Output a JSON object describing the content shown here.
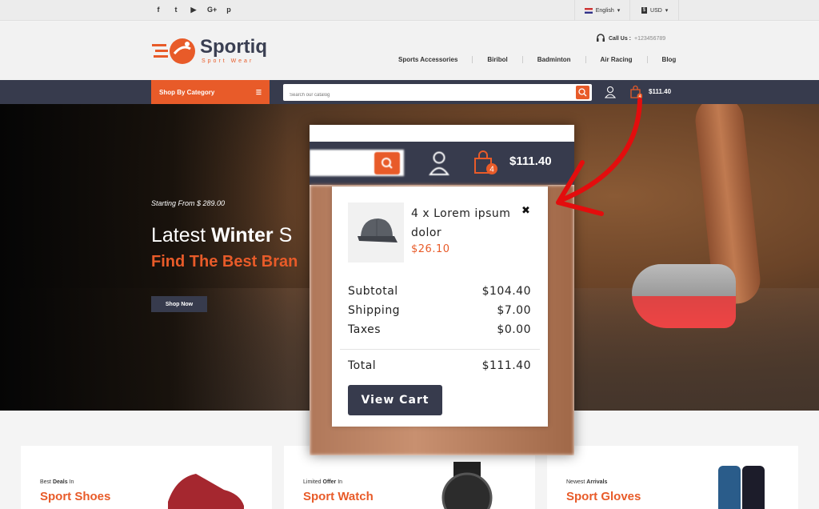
{
  "topbar": {
    "social": [
      "f",
      "t",
      "▶",
      "G+",
      "p"
    ],
    "language": "English",
    "currency": "USD",
    "currency_symbol": "$"
  },
  "header": {
    "logo_text": "Sportiq",
    "logo_sub": "Sport Wear",
    "call_label": "Call Us :",
    "call_number": "+123456789",
    "nav": [
      "Sports Accessories",
      "Biribol",
      "Badminton",
      "Air Racing",
      "Blog"
    ]
  },
  "bar": {
    "shop_by_category": "Shop By Category",
    "search_placeholder": "Search our catalog",
    "cart_count": "4",
    "cart_total": "$111.40"
  },
  "hero": {
    "small": "Starting From $ 289.00",
    "big_light": "Latest ",
    "big_bold": "Winter",
    "big_tail": " S",
    "orange": "Find The Best Bran",
    "button": "Shop Now"
  },
  "cards": [
    {
      "pre_plain": "Best ",
      "pre_bold": "Deals",
      "pre_tail": " In",
      "title": "Sport Shoes"
    },
    {
      "pre_plain": "Limited ",
      "pre_bold": "Offer",
      "pre_tail": " In",
      "title": "Sport Watch"
    },
    {
      "pre_plain": "Newest ",
      "pre_bold": "Arrivals",
      "pre_tail": "",
      "title": "Sport Gloves"
    }
  ],
  "popup": {
    "cart_count": "4",
    "cart_total": "$111.40",
    "item": {
      "name": "4 x  Lorem ipsum dolor",
      "price": "$26.10",
      "close": "✖"
    },
    "subtotal_label": "Subtotal",
    "subtotal": "$104.40",
    "shipping_label": "Shipping",
    "shipping": "$7.00",
    "taxes_label": "Taxes",
    "taxes": "$0.00",
    "total_label": "Total",
    "total": "$111.40",
    "view_cart": "View Cart"
  },
  "colors": {
    "accent": "#e85b29",
    "dark": "#373b4d",
    "arrow": "#e30d0d"
  }
}
